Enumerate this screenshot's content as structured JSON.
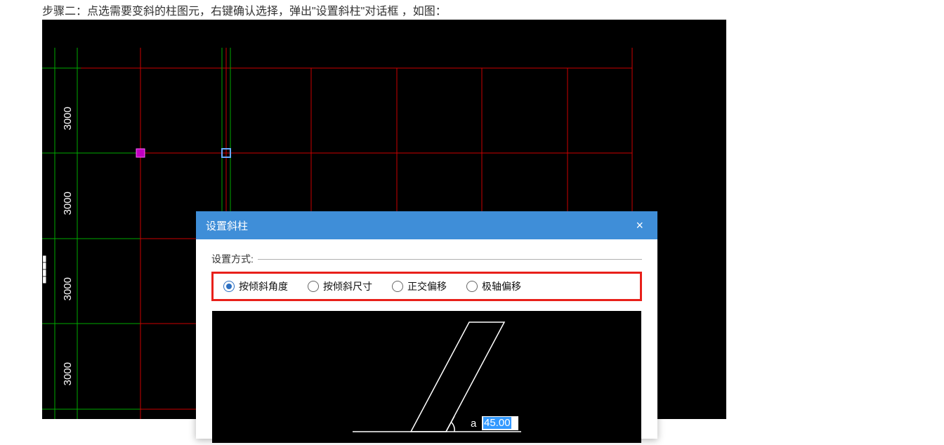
{
  "description": "步骤二：点选需要变斜的柱图元，右键确认选择，弹出\"设置斜柱\"对话框 ，如图：",
  "grid": {
    "labels": [
      "3000",
      "3000",
      "3000",
      "3000"
    ]
  },
  "dialog": {
    "title": "设置斜柱",
    "close_label": "×",
    "group_label": "设置方式:",
    "radios": [
      {
        "label": "按倾斜角度",
        "selected": true
      },
      {
        "label": "按倾斜尺寸",
        "selected": false
      },
      {
        "label": "正交偏移",
        "selected": false
      },
      {
        "label": "极轴偏移",
        "selected": false
      }
    ],
    "angle_symbol": "a",
    "angle_value": "45.00"
  }
}
